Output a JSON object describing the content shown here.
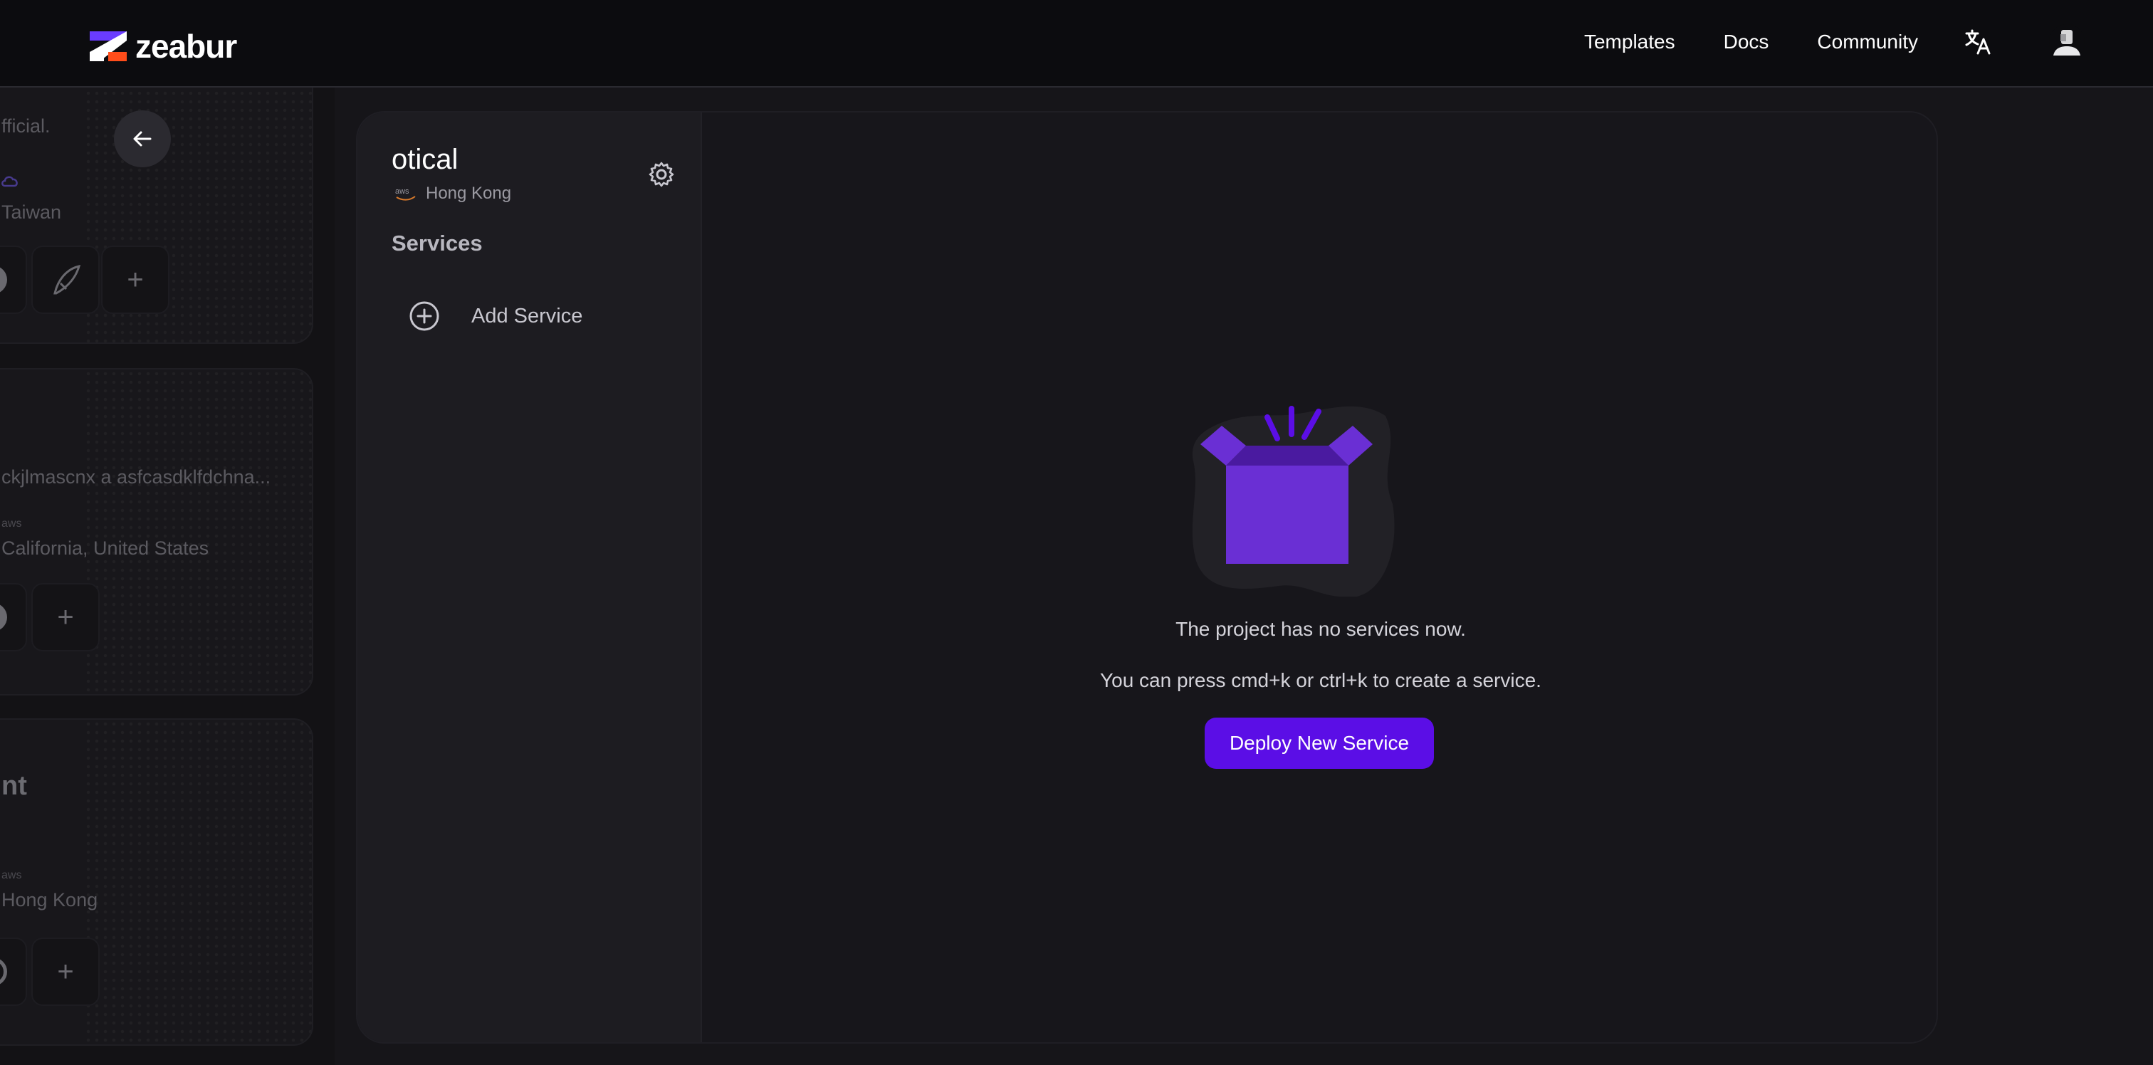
{
  "navbar": {
    "brand": "zeabur",
    "links": [
      "Templates",
      "Docs",
      "Community"
    ],
    "translate_icon": "translate-icon",
    "avatar_icon": "user-avatar"
  },
  "background_cards": [
    {
      "description": "fficial.",
      "region": "Taiwan",
      "provider_icon": "cloud-icon"
    },
    {
      "description": "ckjlmascnx a asfcasdklfdchna...",
      "provider": "aws",
      "region": "California, United States"
    },
    {
      "title": "nt",
      "provider": "aws",
      "region": "Hong Kong"
    }
  ],
  "project": {
    "name": "otical",
    "provider": "aws",
    "region": "Hong Kong",
    "services_heading": "Services",
    "add_service_label": "Add Service"
  },
  "empty_state": {
    "title": "The project has no services now.",
    "hint": "You can press cmd+k or ctrl+k to create a service.",
    "button_label": "Deploy New Service"
  },
  "colors": {
    "accent": "#5b0ee6",
    "box_purple": "#6a2fd4",
    "background": "#161519",
    "navbar": "#0c0c0f"
  }
}
